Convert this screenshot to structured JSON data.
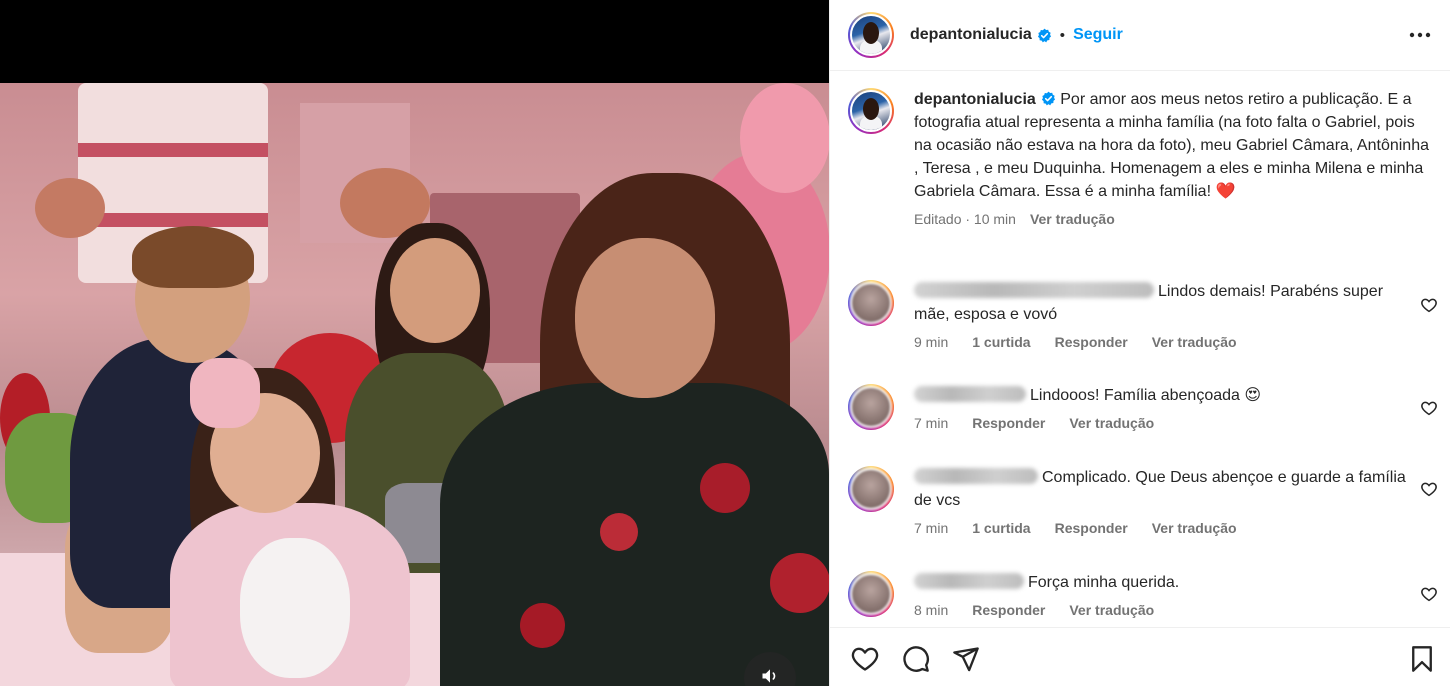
{
  "post": {
    "username": "depantonialucia",
    "follow_label": "Seguir",
    "separator": "•",
    "verified_icon": "verified-badge-icon",
    "accent_color": "#0095f6"
  },
  "caption": {
    "username": "depantonialucia",
    "text": "Por amor aos meus netos retiro a publicação. E a fotografia atual representa a minha família (na foto falta o Gabriel, pois na ocasião não estava na hora da foto), meu Gabriel Câmara, Antôninha , Teresa , e meu Duquinha. Homenagem a eles e minha Milena e minha Gabriela Câmara. Essa é a minha família!",
    "emoji": "❤️",
    "edited": "Editado · 10 min",
    "translate": "Ver tradução"
  },
  "comments": [
    {
      "text": "Lindos demais! Parabéns super mãe, esposa e vovó",
      "time": "9 min",
      "likes": "1 curtida",
      "reply": "Responder",
      "translate": "Ver tradução"
    },
    {
      "text": "Lindooos! Família abençoada 😍",
      "time": "7 min",
      "likes": "",
      "reply": "Responder",
      "translate": "Ver tradução"
    },
    {
      "text": "Complicado. Que Deus abençoe e guarde a família de vcs",
      "time": "7 min",
      "likes": "1 curtida",
      "reply": "Responder",
      "translate": "Ver tradução"
    },
    {
      "text": "Força minha querida.",
      "time": "8 min",
      "likes": "",
      "reply": "Responder",
      "translate": "Ver tradução"
    }
  ],
  "icons": {
    "more": "more-options-icon",
    "like": "heart-icon",
    "comment": "comment-icon",
    "share": "share-icon",
    "save": "bookmark-icon",
    "audio": "speaker-icon"
  }
}
